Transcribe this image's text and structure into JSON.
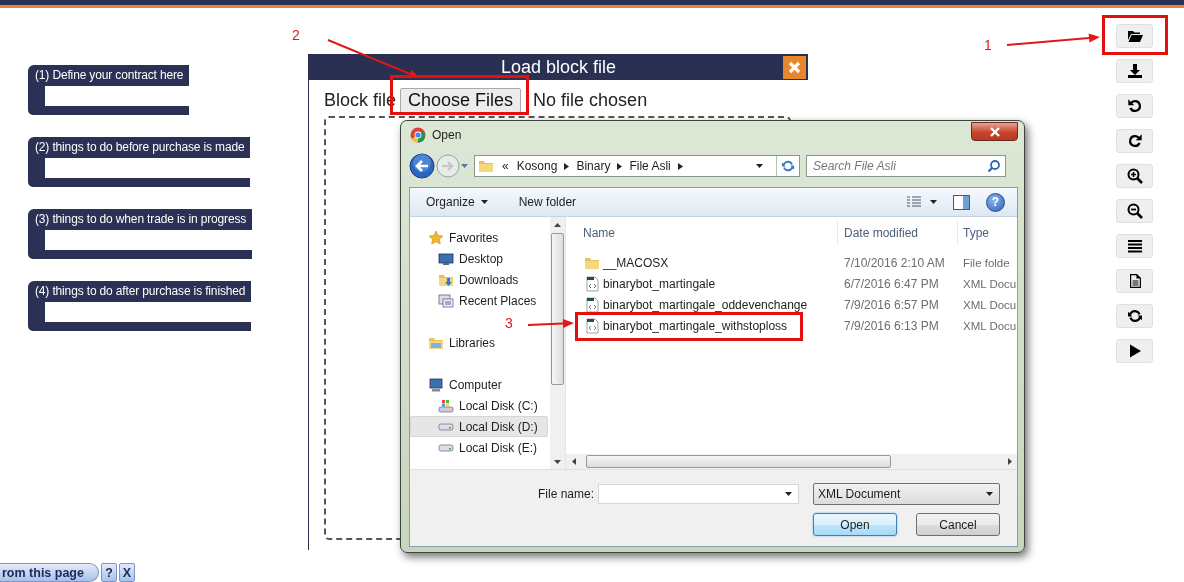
{
  "annotations": [
    {
      "label": "1"
    },
    {
      "label": "2"
    },
    {
      "label": "3"
    }
  ],
  "blocks": [
    {
      "label": "(1) Define your contract here"
    },
    {
      "label": "(2) things to do before purchase is made"
    },
    {
      "label": "(3) things to do when trade is in progress"
    },
    {
      "label": "(4) things to do after purchase is finished"
    }
  ],
  "toolbar": [
    {
      "kind": "open"
    },
    {
      "kind": "download"
    },
    {
      "kind": "undo"
    },
    {
      "kind": "redo"
    },
    {
      "kind": "zoom-in"
    },
    {
      "kind": "zoom-out"
    },
    {
      "kind": "list"
    },
    {
      "kind": "document"
    },
    {
      "kind": "refresh"
    },
    {
      "kind": "play"
    }
  ],
  "load_dialog": {
    "title": "Load block file",
    "field_label": "Block file",
    "button": "Choose Files",
    "status": "No file chosen"
  },
  "open_dialog": {
    "title": "Open",
    "address": {
      "overflow": "«",
      "path": [
        "Kosong",
        "Binary",
        "File Asli"
      ]
    },
    "search": {
      "placeholder": "Search File Asli"
    },
    "commands": [
      {
        "label": "Organize",
        "menu": true
      },
      {
        "label": "New folder",
        "menu": false
      }
    ],
    "help": "?",
    "nav": [
      {
        "label": "Favorites",
        "kind": "favorites",
        "selected": false,
        "children": [
          {
            "label": "Desktop",
            "kind": "desktop",
            "selected": false
          },
          {
            "label": "Downloads",
            "kind": "downloads",
            "selected": false
          },
          {
            "label": "Recent Places",
            "kind": "recent",
            "selected": false
          }
        ]
      },
      {
        "label": "Libraries",
        "kind": "libraries",
        "selected": false
      },
      {
        "label": "Computer",
        "kind": "computer",
        "selected": false,
        "children": [
          {
            "label": "Local Disk (C:)",
            "kind": "system-disk",
            "selected": false
          },
          {
            "label": "Local Disk (D:)",
            "kind": "disk",
            "selected": true
          },
          {
            "label": "Local Disk (E:)",
            "kind": "disk",
            "selected": false
          }
        ]
      }
    ],
    "columns": [
      "Name",
      "Date modified",
      "Type"
    ],
    "files": [
      {
        "kind": "folder",
        "name": "__MACOSX",
        "date": "7/10/2016 2:10 AM",
        "type": "File folde",
        "selected": false
      },
      {
        "kind": "xml",
        "name": "binarybot_martingale",
        "date": "6/7/2016 6:47 PM",
        "type": "XML Docu",
        "selected": false
      },
      {
        "kind": "xml",
        "name": "binarybot_martingale_oddevenchange",
        "date": "7/9/2016 6:57 PM",
        "type": "XML Docu",
        "selected": false
      },
      {
        "kind": "xml",
        "name": "binarybot_martingale_withstoploss",
        "date": "7/9/2016 6:13 PM",
        "type": "XML Docu",
        "selected": false
      }
    ],
    "file_name_label": "File name:",
    "file_type": "XML Document",
    "buttons": [
      {
        "label": "Open",
        "default": true
      },
      {
        "label": "Cancel",
        "default": false
      }
    ]
  },
  "help_bar": {
    "label": "rom this page",
    "help": "?",
    "close": "X"
  }
}
